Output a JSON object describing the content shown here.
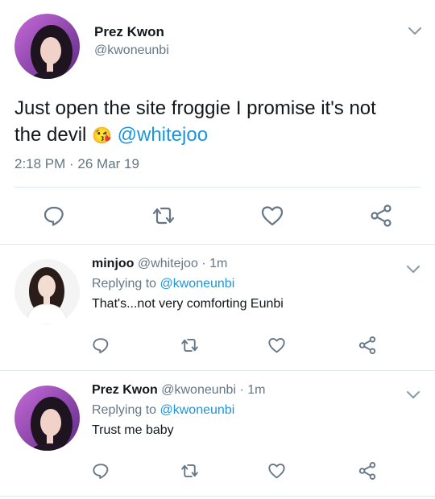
{
  "main_tweet": {
    "author_name": "Prez Kwon",
    "author_handle": "@kwoneunbi",
    "text": "Just open the site froggie I promise it's not",
    "text_line2": "the devil",
    "emoji": "😘",
    "mention": "@whitejoo",
    "timestamp": "2:18 PM · 26 Mar 19"
  },
  "replies": [
    {
      "author_name": "minjoo",
      "author_handle": "@whitejoo",
      "time": "· 1m",
      "replying_label": "Replying to",
      "replying_to": "@kwoneunbi",
      "text": "That's...not very comforting Eunbi"
    },
    {
      "author_name": "Prez Kwon",
      "author_handle": "@kwoneunbi",
      "time": "· 1m",
      "replying_label": "Replying to",
      "replying_to": "@kwoneunbi",
      "text": "Trust me baby"
    }
  ],
  "icons": [
    "reply-icon",
    "retweet-icon",
    "like-icon",
    "share-icon",
    "chevron-down-icon"
  ],
  "colors": {
    "link": "#1b95e0",
    "secondary": "#657786",
    "divider": "#e1e8ed",
    "icon": "#657786"
  }
}
